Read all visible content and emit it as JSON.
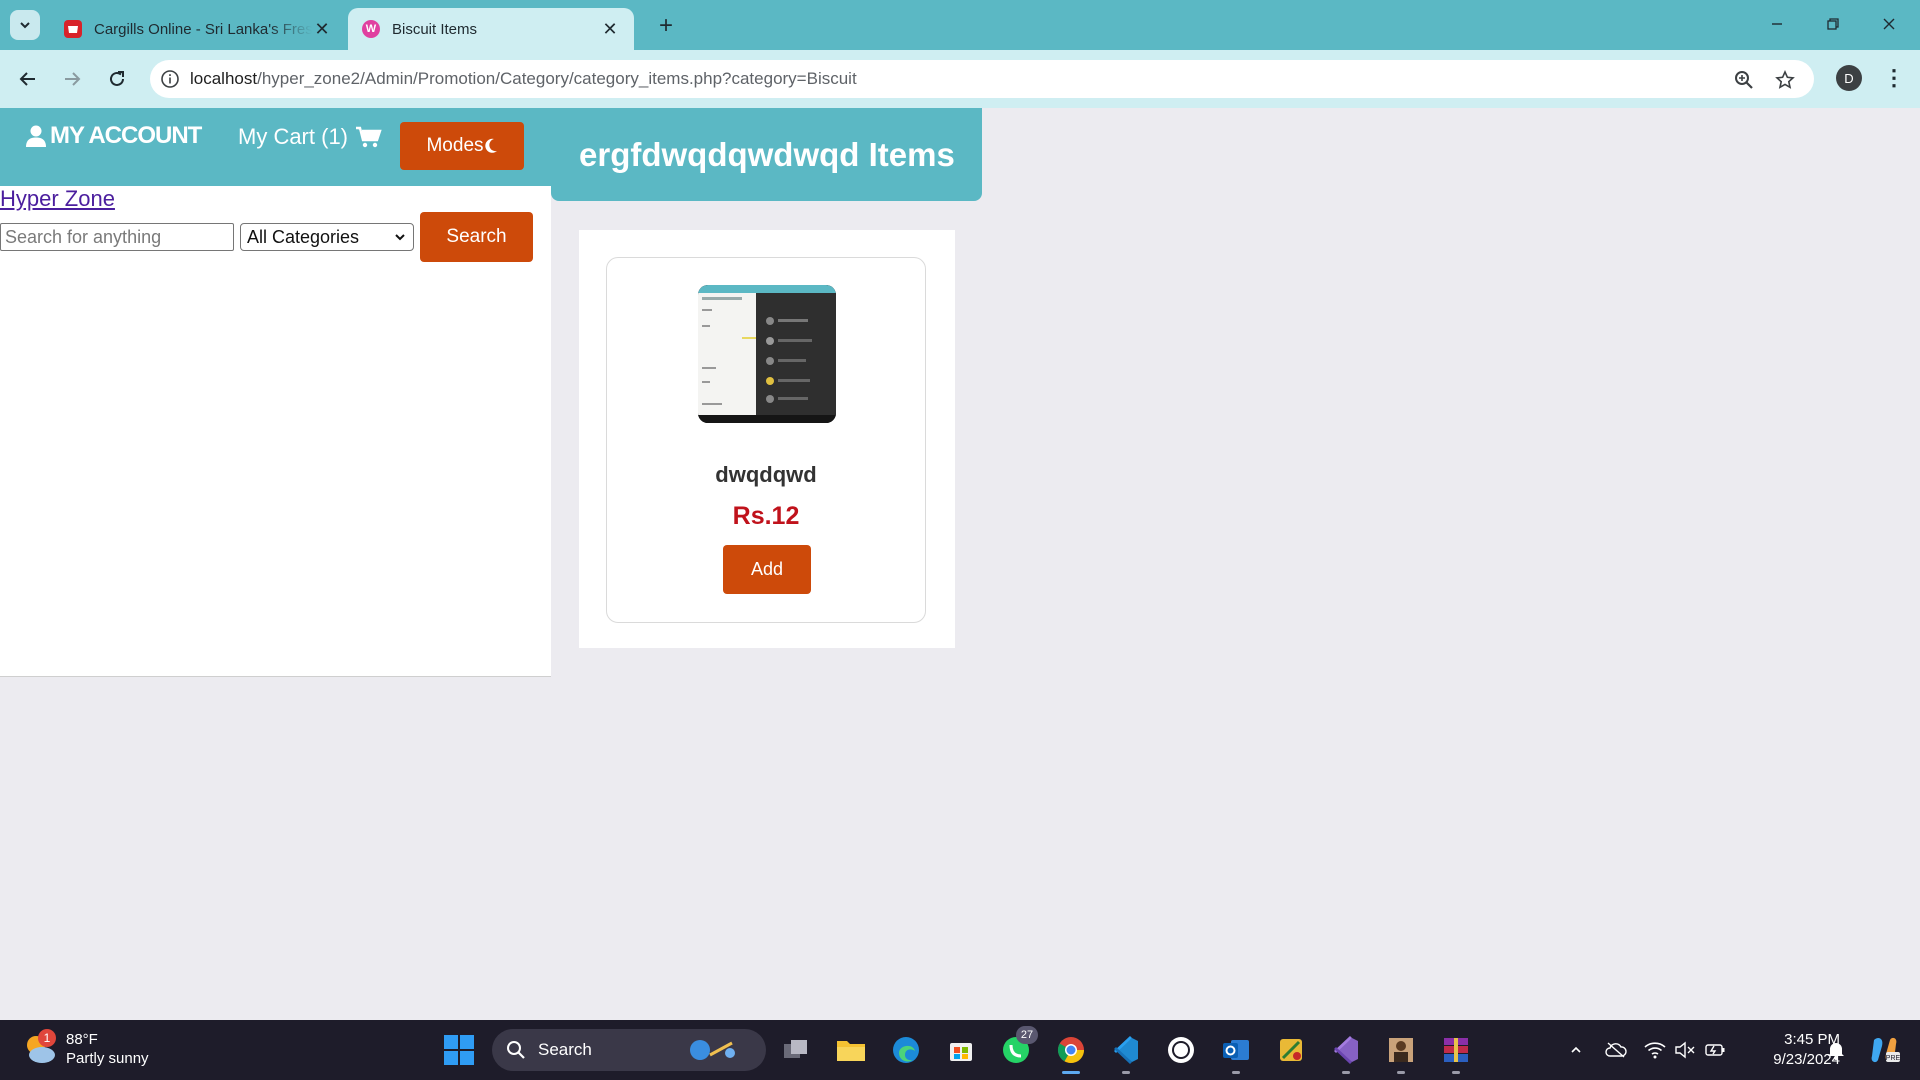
{
  "browser": {
    "tabs": [
      {
        "title": "Cargills Online - Sri Lanka's Fres",
        "active": false
      },
      {
        "title": "Biscuit Items",
        "active": true
      }
    ],
    "url_host": "localhost",
    "url_path": "/hyper_zone2/Admin/Promotion/Category/category_items.php?category=Biscuit",
    "profile_initial": "D"
  },
  "header": {
    "my_account": "MY ACCOUNT",
    "cart_label": "My Cart (1)",
    "modes_label": "Modes"
  },
  "brand": "Hyper Zone",
  "search": {
    "placeholder": "Search for anything",
    "category_selected": "All Categories",
    "button_label": "Search"
  },
  "section": {
    "title": "ergfdwqdqwdwqd Items"
  },
  "products": [
    {
      "name": "dwqdqwd",
      "price": "Rs.12",
      "add_label": "Add"
    }
  ],
  "taskbar": {
    "weather_temp": "88°F",
    "weather_desc": "Partly sunny",
    "weather_badge": "1",
    "search_label": "Search",
    "whatsapp_badge": "27",
    "time": "3:45 PM",
    "date": "9/23/2024"
  },
  "colors": {
    "teal": "#5bb8c4",
    "accent_orange": "#cd4a0a",
    "price_red": "#c0121b"
  }
}
